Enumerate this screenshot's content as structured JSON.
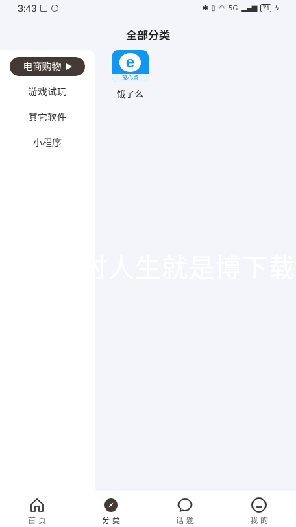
{
  "status_bar": {
    "time": "3:43",
    "network": "5G",
    "battery": "71"
  },
  "header": {
    "title": "全部分类"
  },
  "sidebar": {
    "items": [
      {
        "label": "电商购物",
        "active": true
      },
      {
        "label": "游戏试玩",
        "active": false
      },
      {
        "label": "其它软件",
        "active": false
      },
      {
        "label": "小程序",
        "active": false
      }
    ]
  },
  "apps": [
    {
      "name": "饿了么",
      "icon_letter": "e",
      "icon_caption": "放心点",
      "icon": "eleme-app-icon"
    }
  ],
  "watermark": "时人生就是博下载",
  "bottom_nav": {
    "items": [
      {
        "label": "首页",
        "icon": "home-icon",
        "active": false
      },
      {
        "label": "分类",
        "icon": "compass-icon",
        "active": true
      },
      {
        "label": "话题",
        "icon": "chat-bubble-icon",
        "active": false
      },
      {
        "label": "我的",
        "icon": "profile-face-icon",
        "active": false
      }
    ]
  },
  "colors": {
    "background": "#f4f5fa",
    "active_pill": "#443a35",
    "app_icon_blue": "#1296f0"
  }
}
